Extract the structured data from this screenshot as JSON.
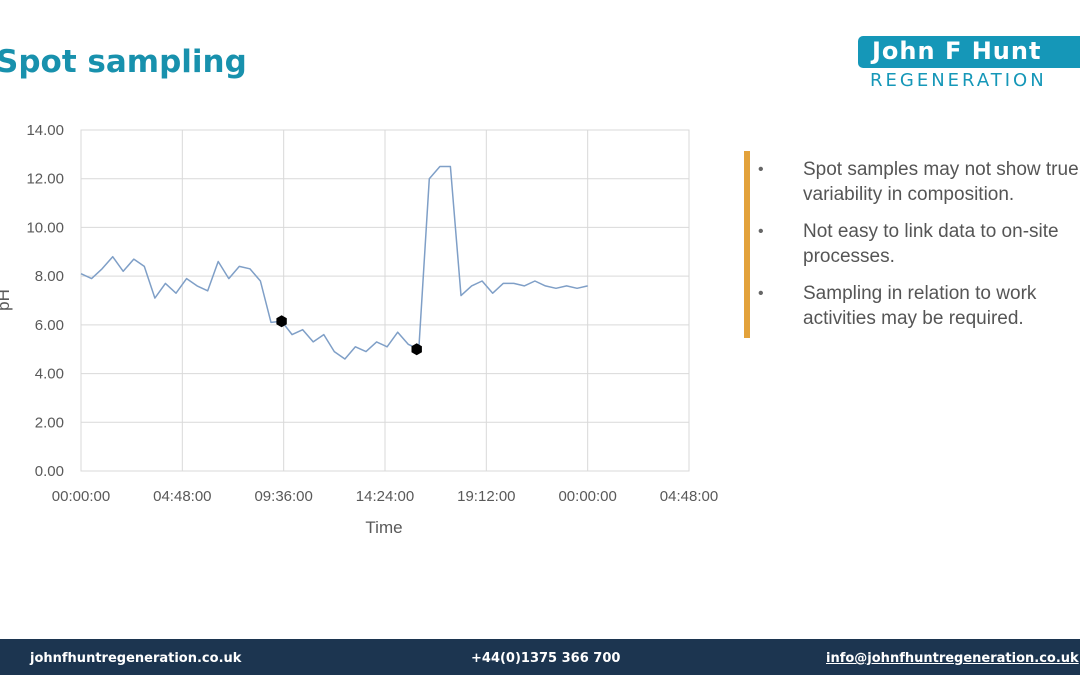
{
  "header": {
    "title": "Spot sampling",
    "logo_top": "John F Hunt",
    "logo_bottom": "REGENERATION"
  },
  "bullets": [
    "Spot samples may not show true variability in composition.",
    "Not easy to link data to on-site processes.",
    "Sampling in relation to work activities may be required."
  ],
  "footer": {
    "website": "johnfhuntregeneration.co.uk",
    "phone": "+44(0)1375 366 700",
    "email": "info@johnfhuntregeneration.co.uk"
  },
  "colors": {
    "title": "#1891ad",
    "line": "#7f9fc7",
    "accent_bar": "#e3a23b",
    "footer_bg": "#1c3550"
  },
  "chart_data": {
    "type": "line",
    "title": "",
    "xlabel": "Time",
    "ylabel": "pH",
    "ylim": [
      0,
      14
    ],
    "y_ticks": [
      "0.00",
      "2.00",
      "4.00",
      "6.00",
      "8.00",
      "10.00",
      "12.00",
      "14.00"
    ],
    "x_ticks": [
      "00:00:00",
      "04:48:00",
      "09:36:00",
      "14:24:00",
      "19:12:00",
      "00:00:00",
      "04:48:00"
    ],
    "x_tick_hours": [
      0,
      4.8,
      9.6,
      14.4,
      19.2,
      24,
      28.8
    ],
    "xlim_hours": [
      0,
      28.8
    ],
    "grid": true,
    "series": [
      {
        "x_hours": [
          0,
          0.5,
          1,
          1.5,
          2,
          2.5,
          3,
          3.5,
          4,
          4.5,
          5,
          5.5,
          6,
          6.5,
          7,
          7.5,
          8,
          8.5,
          9,
          9.5,
          10,
          10.5,
          11,
          11.5,
          12,
          12.5,
          13,
          13.5,
          14,
          14.5,
          15,
          15.5,
          16,
          16.5,
          17,
          17.5,
          18,
          18.5,
          19,
          19.5,
          20,
          20.5,
          21,
          21.5,
          22,
          22.5,
          23,
          23.5,
          24
        ],
        "y": [
          8.1,
          7.9,
          8.3,
          8.8,
          8.2,
          8.7,
          8.4,
          7.1,
          7.7,
          7.3,
          7.9,
          7.6,
          7.4,
          8.6,
          7.9,
          8.4,
          8.3,
          7.8,
          6.1,
          6.15,
          5.6,
          5.8,
          5.3,
          5.6,
          4.9,
          4.6,
          5.1,
          4.9,
          5.3,
          5.1,
          5.7,
          5.2,
          5.0,
          12.0,
          12.5,
          12.5,
          7.2,
          7.6,
          7.8,
          7.3,
          7.7,
          7.7,
          7.6,
          7.8,
          7.6,
          7.5,
          7.6,
          7.5,
          7.6
        ]
      }
    ],
    "highlight_points": [
      {
        "x_hours": 9.5,
        "y": 6.15
      },
      {
        "x_hours": 15.9,
        "y": 5.0
      }
    ]
  }
}
